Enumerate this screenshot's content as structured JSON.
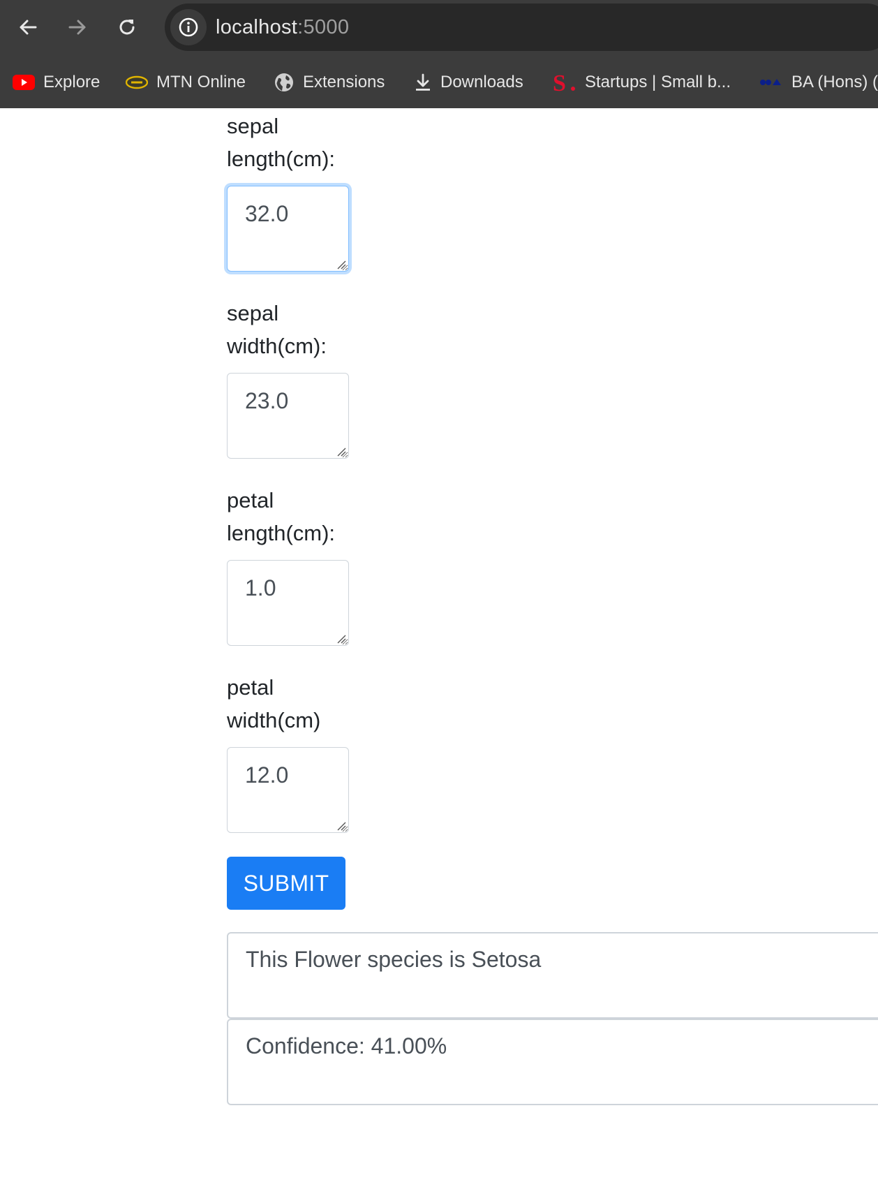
{
  "browser": {
    "url_host": "localhost",
    "url_port": ":5000",
    "bookmarks": [
      {
        "label": "Explore",
        "icon": "youtube-icon"
      },
      {
        "label": "MTN Online",
        "icon": "mtn-logo-icon"
      },
      {
        "label": "Extensions",
        "icon": "globe-icon"
      },
      {
        "label": "Downloads",
        "icon": "download-icon"
      },
      {
        "label": "Startups | Small b...",
        "icon": "s-logo-icon"
      },
      {
        "label": "BA (Hons) (",
        "icon": "bookmark-favicon-icon"
      }
    ]
  },
  "form": {
    "fields": [
      {
        "label_line1": "sepal",
        "label_line2": "length(cm):",
        "value": "32.0"
      },
      {
        "label_line1": "sepal",
        "label_line2": "width(cm):",
        "value": "23.0"
      },
      {
        "label_line1": "petal",
        "label_line2": "length(cm):",
        "value": "1.0"
      },
      {
        "label_line1": "petal",
        "label_line2": "width(cm)",
        "value": "12.0"
      }
    ],
    "submit_label": "SUBMIT"
  },
  "results": {
    "species": "This Flower species is Setosa",
    "confidence": "Confidence: 41.00%"
  },
  "colors": {
    "primary": "#1a7df4",
    "focus": "#80bdff",
    "chrome": "#3c3c3c"
  }
}
